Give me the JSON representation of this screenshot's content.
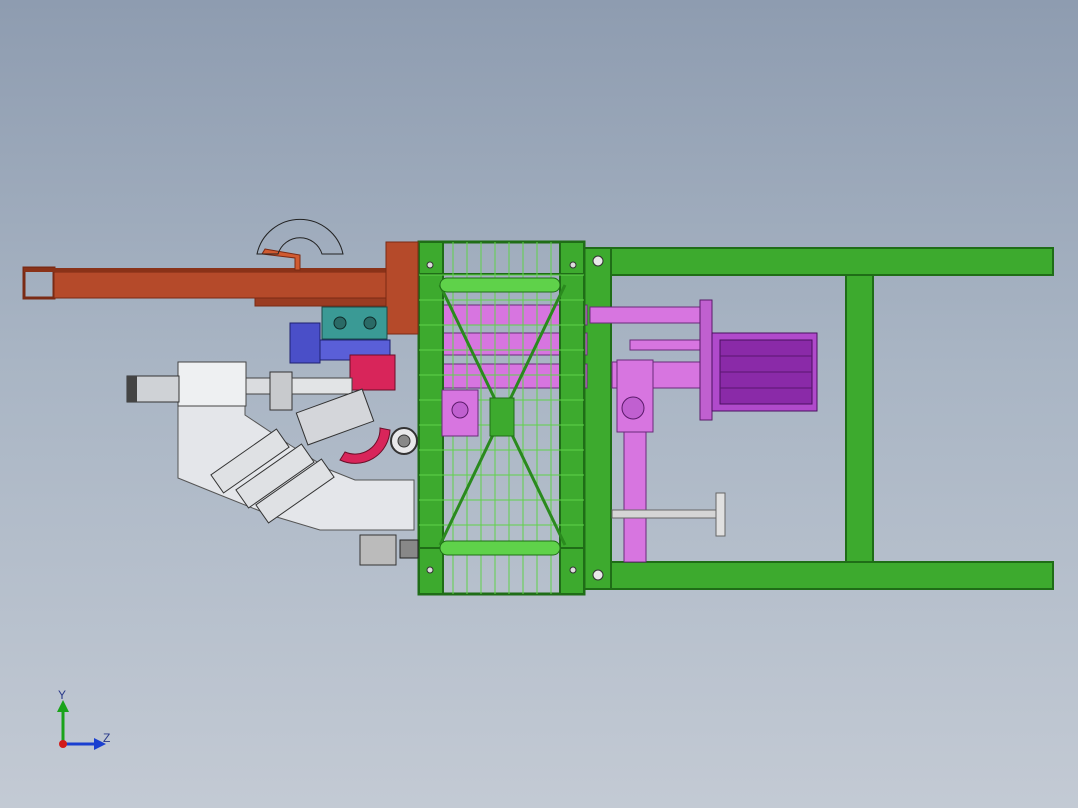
{
  "view": {
    "name": "cad-model-viewport",
    "background_top": "#8e9cb0",
    "background_bottom": "#c3cad4"
  },
  "colors": {
    "frame_green": "#3daa2e",
    "frame_green_dark": "#1f6d17",
    "mesh_green": "#5fd24a",
    "beam_rust": "#b54a2a",
    "cylinder_magenta": "#d775e0",
    "motor_purple": "#8a2aa8",
    "blue_block": "#4a4fc8",
    "teal_block": "#3a9a95",
    "red_part": "#d8255a",
    "steel_grey": "#d2d4d8"
  },
  "triad": {
    "y_label": "Y",
    "z_label": "Z",
    "y_color": "#1aa31a",
    "z_color": "#1a3fd0",
    "x_color": "#d21a1a"
  }
}
